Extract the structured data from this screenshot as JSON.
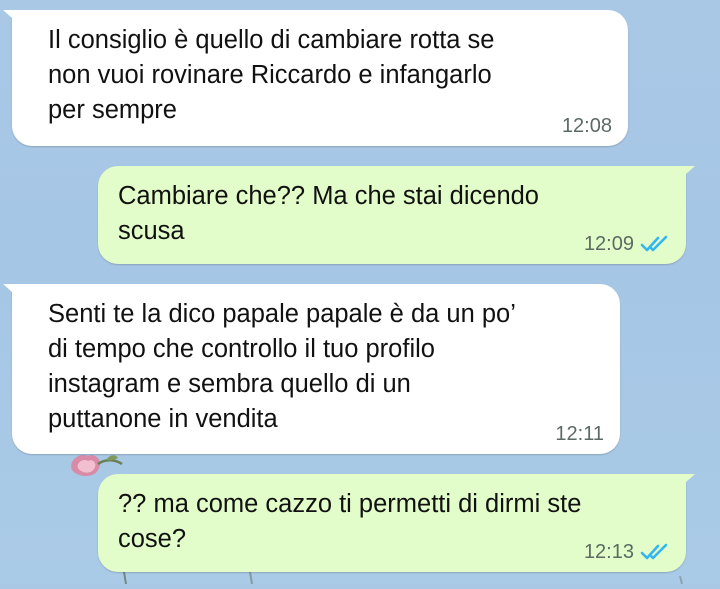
{
  "chat": {
    "messages": [
      {
        "direction": "incoming",
        "text": "Il consiglio è quello di cambiare rotta se\nnon vuoi rovinare Riccardo e infangarlo\nper sempre",
        "time": "12:08"
      },
      {
        "direction": "outgoing",
        "text": "Cambiare che?? Ma che stai dicendo\nscusa",
        "time": "12:09",
        "status_icon": "double-check-read-icon"
      },
      {
        "direction": "incoming",
        "text": "Senti te la dico papale papale è da un po’\ndi tempo che controllo il tuo profilo\ninstagram e sembra quello di un\nputtanone in vendita",
        "time": "12:11"
      },
      {
        "direction": "outgoing",
        "text": "?? ma come cazzo ti permetti di dirmi ste\ncose?",
        "time": "12:13",
        "status_icon": "double-check-read-icon"
      }
    ]
  },
  "colors": {
    "incoming_bubble": "#ffffff",
    "outgoing_bubble": "#e2fdc9",
    "read_tick": "#34b7f1",
    "wallpaper": "#a8c8e6"
  }
}
